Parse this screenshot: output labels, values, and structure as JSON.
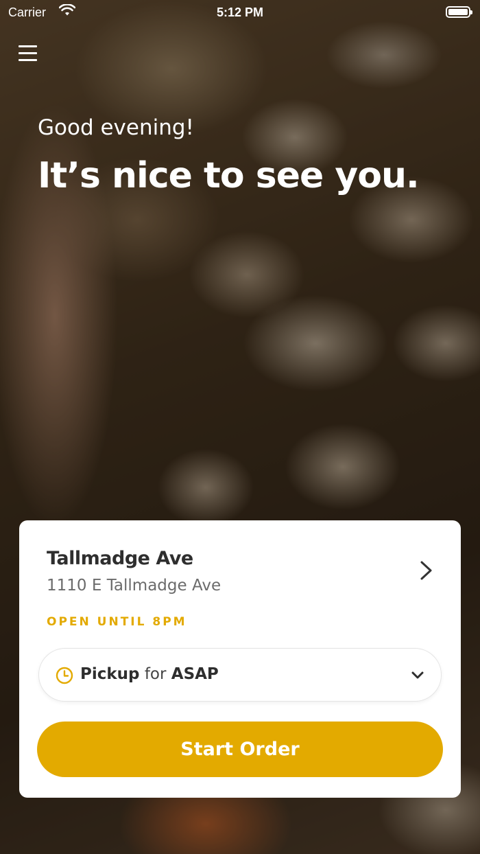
{
  "status_bar": {
    "carrier": "Carrier",
    "time": "5:12 PM"
  },
  "hero": {
    "greeting": "Good evening!",
    "headline": "It’s nice to see you."
  },
  "location_card": {
    "store_name": "Tallmadge Ave",
    "address": "1110 E Tallmadge Ave",
    "hours": "OPEN UNTIL 8PM",
    "order_mode": {
      "mode": "Pickup",
      "connector": "for",
      "time": "ASAP"
    },
    "start_order_label": "Start Order"
  },
  "icons": [
    "wifi-icon",
    "battery-icon",
    "menu-icon",
    "chevron-right-icon",
    "clock-icon",
    "chevron-down-icon"
  ],
  "colors": {
    "accent": "#e3aa00",
    "text_dark": "#2e2e2e",
    "text_muted": "#6b6b6b"
  }
}
